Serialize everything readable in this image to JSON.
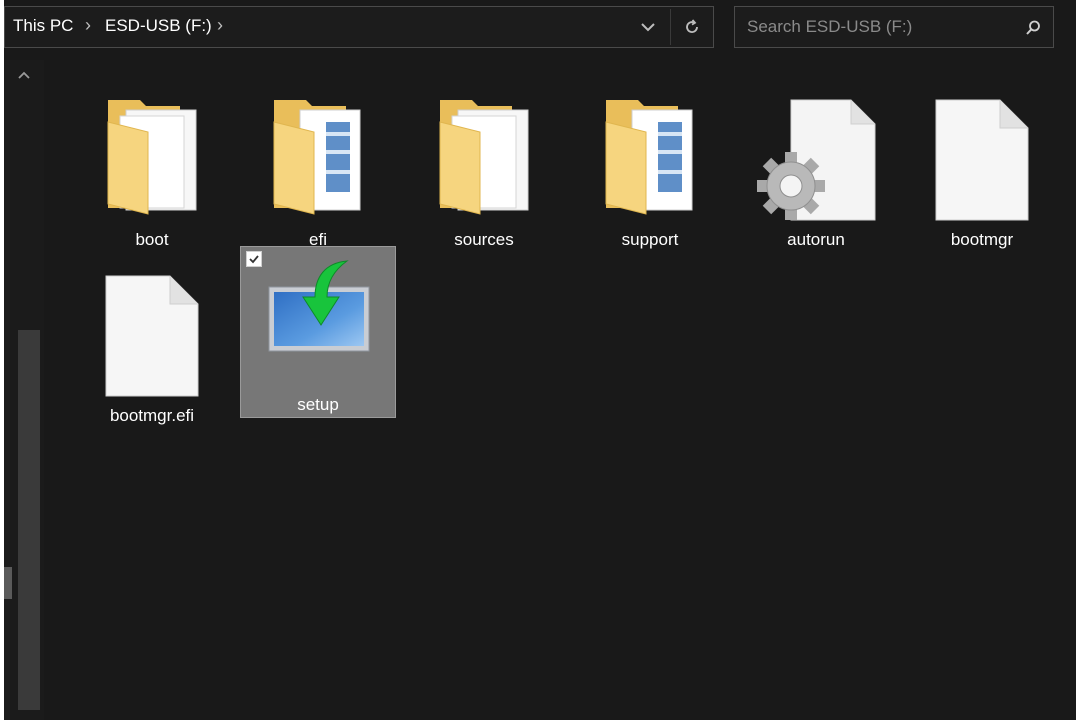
{
  "breadcrumb": {
    "items": [
      "This PC",
      "ESD-USB (F:)"
    ],
    "separator": "›"
  },
  "address_bar": {
    "dropdown_icon": "chevron-down-icon",
    "refresh_icon": "refresh-icon"
  },
  "search": {
    "placeholder": "Search ESD-USB (F:)",
    "icon": "search-icon"
  },
  "files": [
    {
      "name": "boot",
      "type": "folder",
      "icon": "folder-icon",
      "selected": false
    },
    {
      "name": "efi",
      "type": "folder",
      "icon": "folder-icon",
      "selected": false
    },
    {
      "name": "sources",
      "type": "folder",
      "icon": "folder-icon",
      "selected": false
    },
    {
      "name": "support",
      "type": "folder",
      "icon": "folder-icon",
      "selected": false
    },
    {
      "name": "autorun",
      "type": "settings-file",
      "icon": "gear-file-icon",
      "selected": false
    },
    {
      "name": "bootmgr",
      "type": "file",
      "icon": "blank-file-icon",
      "selected": false
    },
    {
      "name": "bootmgr.efi",
      "type": "file",
      "icon": "blank-file-icon",
      "selected": false
    },
    {
      "name": "setup",
      "type": "installer",
      "icon": "setup-icon",
      "selected": true
    }
  ],
  "colors": {
    "background": "#191919",
    "selected_item": "#777777",
    "folder": "#f3d27a",
    "text": "#ffffff"
  }
}
